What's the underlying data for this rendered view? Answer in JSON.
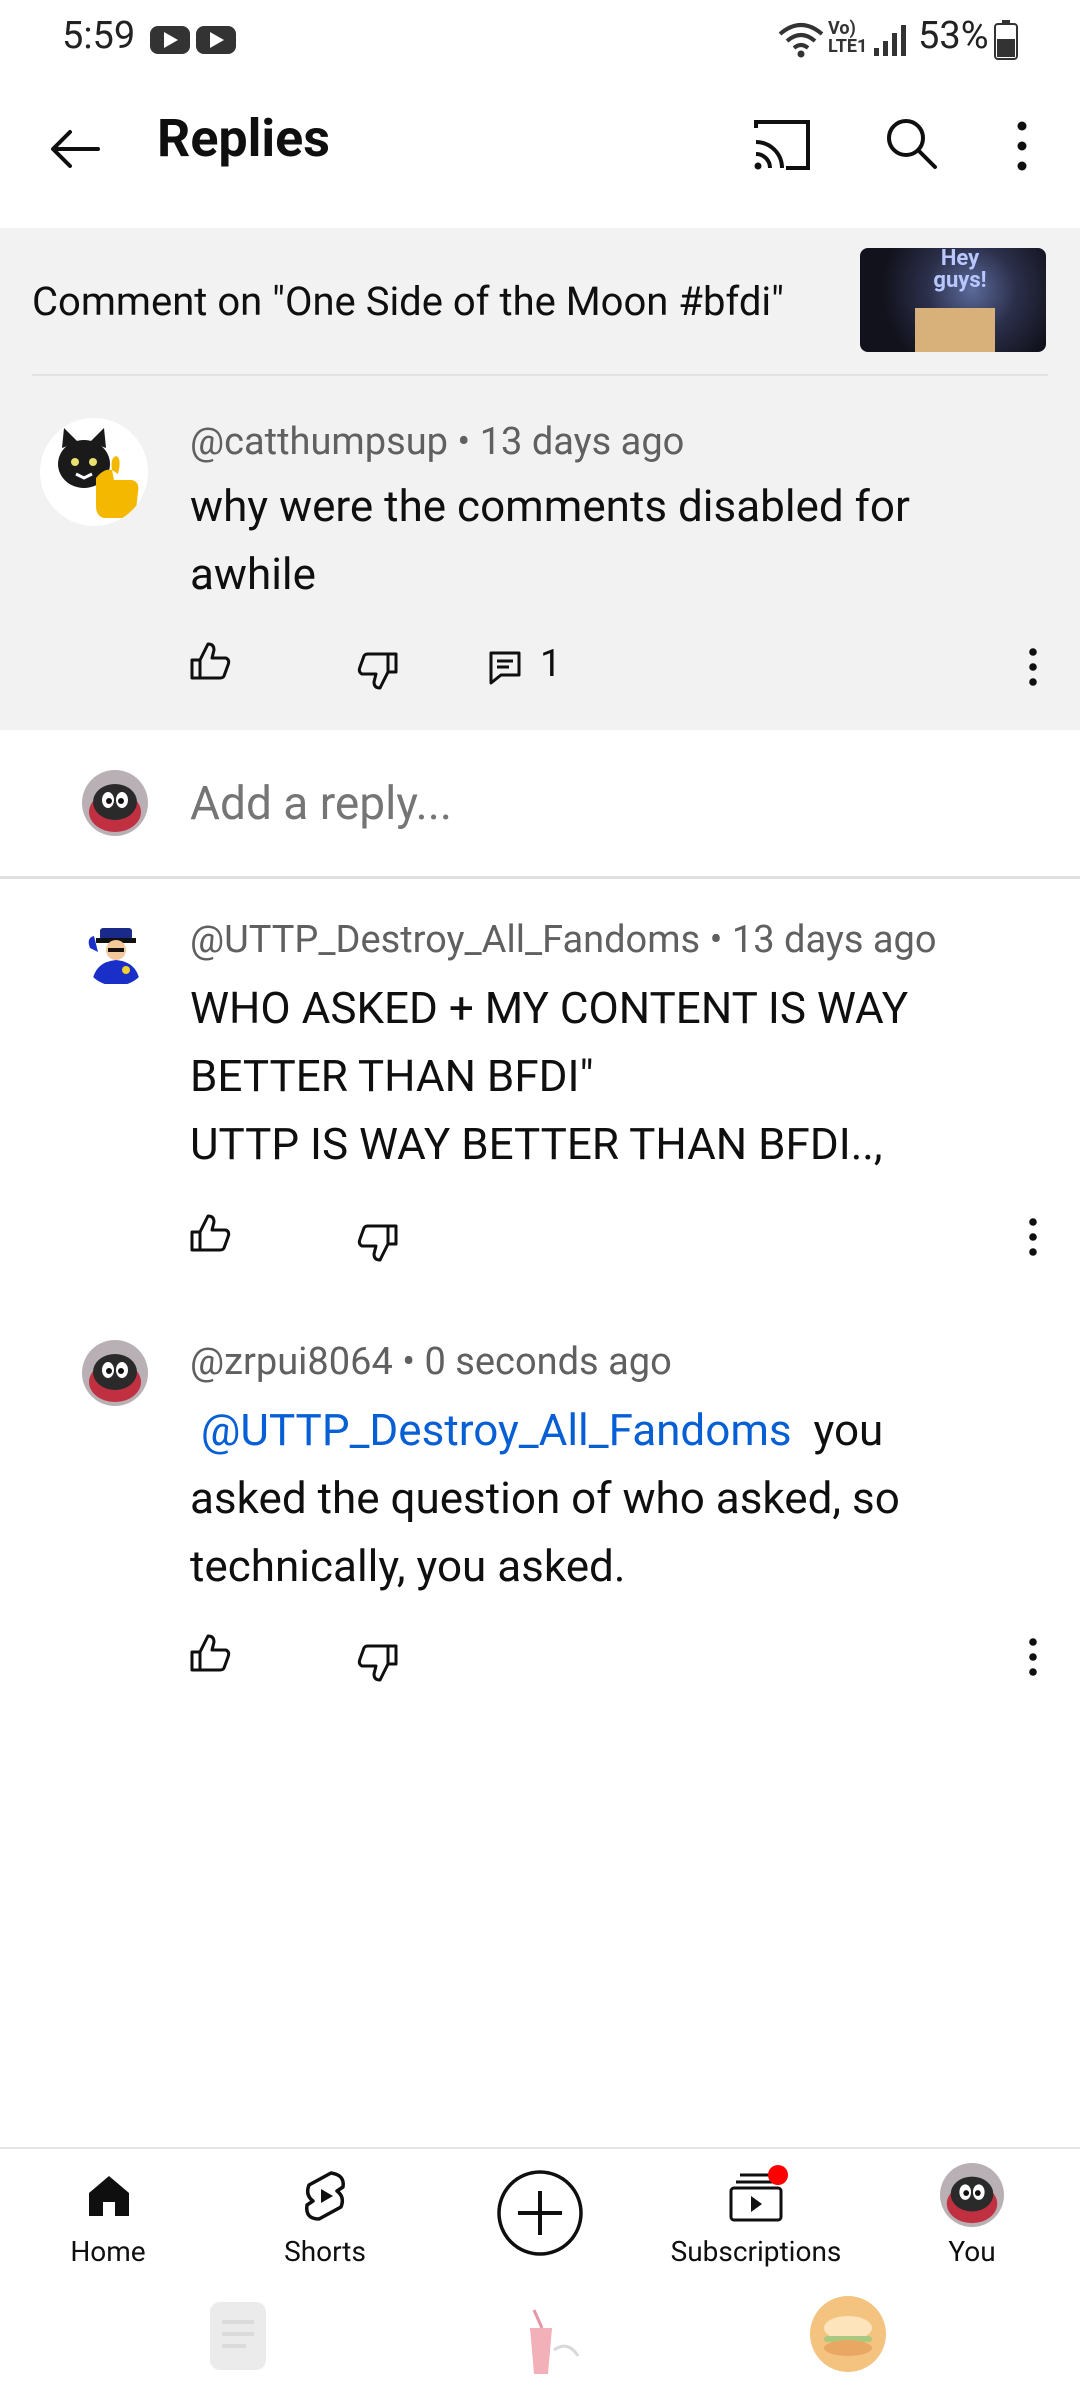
{
  "status_bar": {
    "time": "5:59",
    "network": "Vo) LTE1",
    "battery": "53%"
  },
  "app_bar": {
    "title": "Replies"
  },
  "header": {
    "comment_on": "Comment on \"One Side of the Moon #bfdi\"",
    "thumbnail_text": "Hey guys!"
  },
  "parent_comment": {
    "author": "@catthumpsup",
    "time": "13 days ago",
    "text_line1": "why were the comments disabled for",
    "text_line2": "awhile",
    "reply_count": "1"
  },
  "reply_input": {
    "placeholder": "Add a reply..."
  },
  "replies": [
    {
      "author": "@UTTP_Destroy_All_Fandoms",
      "time": "13 days ago",
      "line1": "WHO ASKED + MY CONTENT IS WAY",
      "line2": "BETTER THAN BFDI\"",
      "line3": "UTTP IS WAY BETTER THAN BFDI..,"
    },
    {
      "author": "@zrpui8064",
      "time": "0 seconds ago",
      "mention": "@UTTP_Destroy_All_Fandoms",
      "line1_rest": "you",
      "line2": "asked the question of who asked, so",
      "line3": "technically, you asked."
    }
  ],
  "separator": "•",
  "bottom_nav": {
    "home": "Home",
    "shorts": "Shorts",
    "subscriptions": "Subscriptions",
    "you": "You"
  },
  "colors": {
    "mention": "#065fd4",
    "notification_dot": "#ff0000",
    "highlight_bg": "#f2f2f2"
  }
}
